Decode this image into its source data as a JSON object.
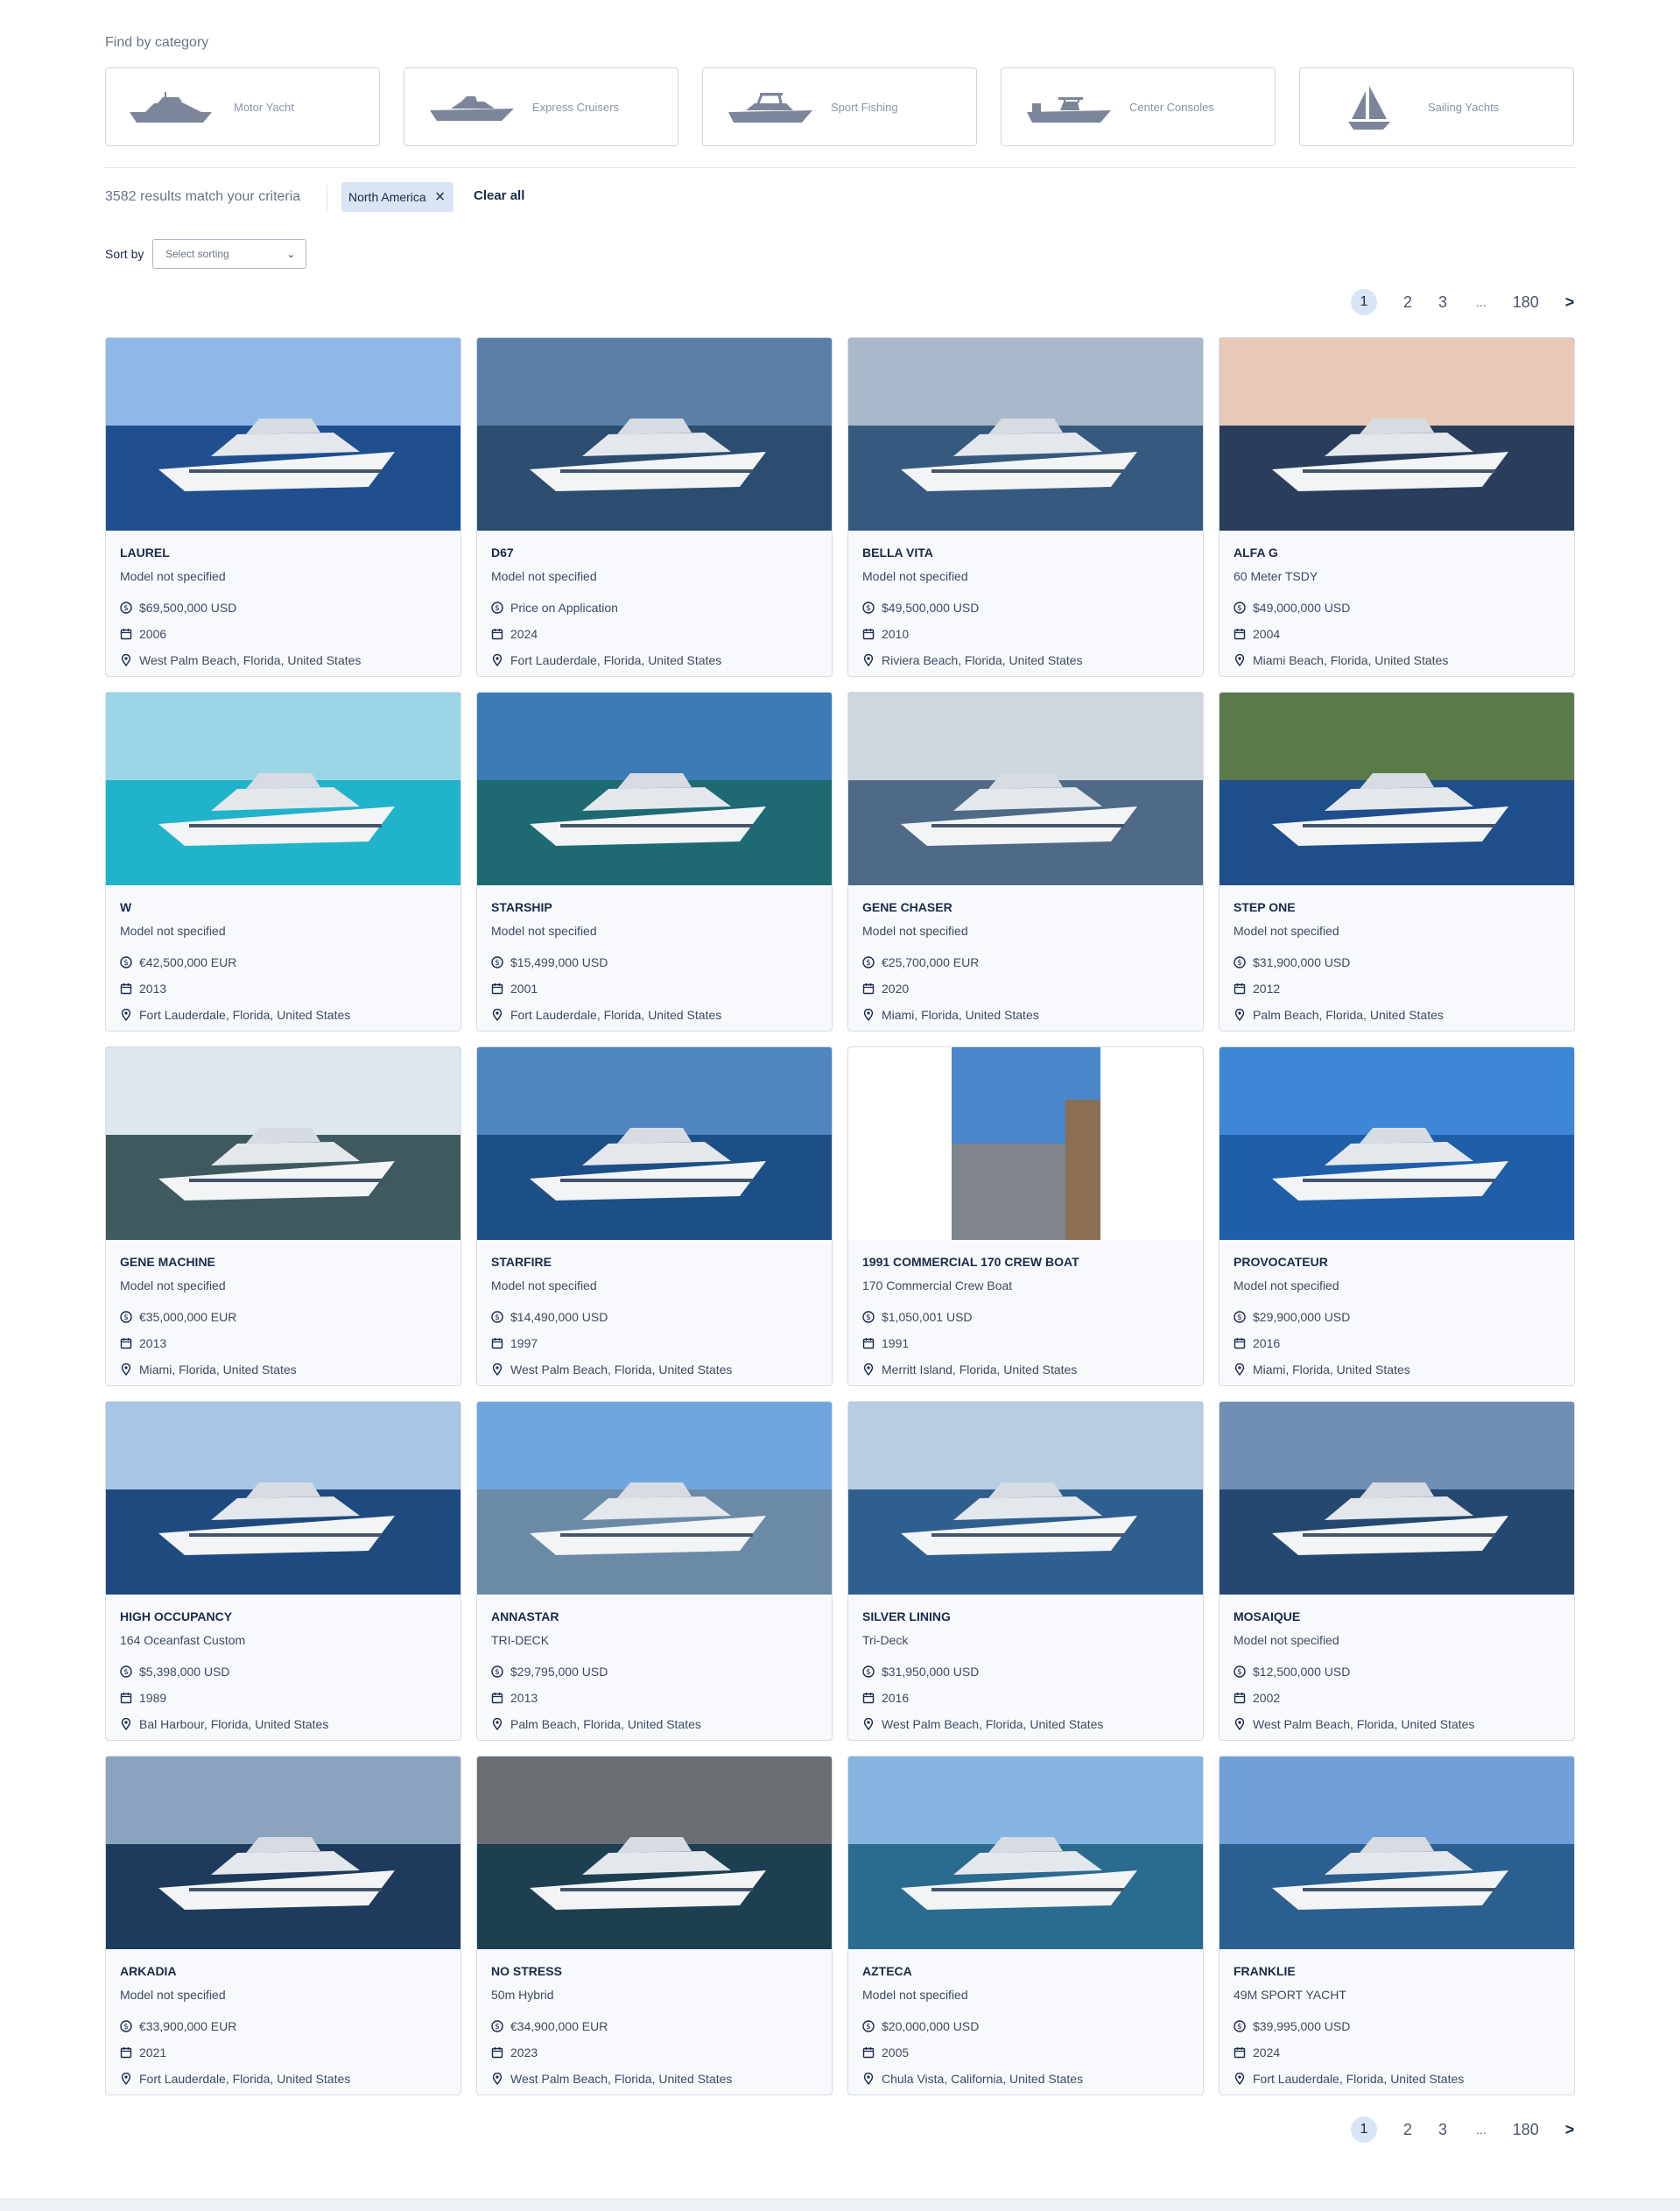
{
  "find_title": "Find by category",
  "categories": [
    {
      "label": "Motor Yacht",
      "icon": "motor-yacht-icon"
    },
    {
      "label": "Express Cruisers",
      "icon": "express-cruiser-icon"
    },
    {
      "label": "Sport Fishing",
      "icon": "sport-fishing-icon"
    },
    {
      "label": "Center Consoles",
      "icon": "center-console-icon"
    },
    {
      "label": "Sailing Yachts",
      "icon": "sailboat-icon"
    }
  ],
  "results_text": "3582 results match your criteria",
  "filter_chip": "North America",
  "clear_all": "Clear all",
  "sort": {
    "label": "Sort by",
    "placeholder": "Select sorting"
  },
  "pagination": {
    "current": "1",
    "pages": [
      "2",
      "3"
    ],
    "dots": "...",
    "last": "180",
    "next": ">"
  },
  "colors": {
    "accent": "#d9e4f5",
    "text": "#1b2a4a",
    "icon": "#7c8599"
  },
  "listings": [
    {
      "name": "LAUREL",
      "model": "Model not specified",
      "price": "$69,500,000 USD",
      "year": "2006",
      "location": "West Palm Beach, Florida, United States"
    },
    {
      "name": "D67",
      "model": "Model not specified",
      "price": "Price on Application",
      "year": "2024",
      "location": "Fort Lauderdale, Florida, United States"
    },
    {
      "name": "BELLA VITA",
      "model": "Model not specified",
      "price": "$49,500,000 USD",
      "year": "2010",
      "location": "Riviera Beach, Florida, United States"
    },
    {
      "name": "ALFA G",
      "model": "60 Meter TSDY",
      "price": "$49,000,000 USD",
      "year": "2004",
      "location": "Miami Beach, Florida, United States"
    },
    {
      "name": "W",
      "model": "Model not specified",
      "price": "€42,500,000 EUR",
      "year": "2013",
      "location": "Fort Lauderdale, Florida, United States"
    },
    {
      "name": "STARSHIP",
      "model": "Model not specified",
      "price": "$15,499,000 USD",
      "year": "2001",
      "location": "Fort Lauderdale, Florida, United States"
    },
    {
      "name": "GENE CHASER",
      "model": "Model not specified",
      "price": "€25,700,000 EUR",
      "year": "2020",
      "location": "Miami, Florida, United States"
    },
    {
      "name": "STEP ONE",
      "model": "Model not specified",
      "price": "$31,900,000 USD",
      "year": "2012",
      "location": "Palm Beach, Florida, United States"
    },
    {
      "name": "GENE MACHINE",
      "model": "Model not specified",
      "price": "€35,000,000 EUR",
      "year": "2013",
      "location": "Miami, Florida, United States"
    },
    {
      "name": "STARFIRE",
      "model": "Model not specified",
      "price": "$14,490,000 USD",
      "year": "1997",
      "location": "West Palm Beach, Florida, United States"
    },
    {
      "name": "1991 COMMERCIAL 170 CREW BOAT",
      "model": "170 Commercial Crew Boat",
      "price": "$1,050,001 USD",
      "year": "1991",
      "location": "Merritt Island, Florida, United States"
    },
    {
      "name": "PROVOCATEUR",
      "model": "Model not specified",
      "price": "$29,900,000 USD",
      "year": "2016",
      "location": "Miami, Florida, United States"
    },
    {
      "name": "HIGH OCCUPANCY",
      "model": "164 Oceanfast Custom",
      "price": "$5,398,000 USD",
      "year": "1989",
      "location": "Bal Harbour, Florida, United States"
    },
    {
      "name": "ANNASTAR",
      "model": "TRI-DECK",
      "price": "$29,795,000 USD",
      "year": "2013",
      "location": "Palm Beach, Florida, United States"
    },
    {
      "name": "SILVER LINING",
      "model": "Tri-Deck",
      "price": "$31,950,000 USD",
      "year": "2016",
      "location": "West Palm Beach, Florida, United States"
    },
    {
      "name": "MOSAIQUE",
      "model": "Model not specified",
      "price": "$12,500,000 USD",
      "year": "2002",
      "location": "West Palm Beach, Florida, United States"
    },
    {
      "name": "ARKADIA",
      "model": "Model not specified",
      "price": "€33,900,000 EUR",
      "year": "2021",
      "location": "Fort Lauderdale, Florida, United States"
    },
    {
      "name": "NO STRESS",
      "model": "50m Hybrid",
      "price": "€34,900,000 EUR",
      "year": "2023",
      "location": "West Palm Beach, Florida, United States"
    },
    {
      "name": "AZTECA",
      "model": "Model not specified",
      "price": "$20,000,000 USD",
      "year": "2005",
      "location": "Chula Vista, California, United States"
    },
    {
      "name": "FRANKLIE",
      "model": "49M SPORT YACHT",
      "price": "$39,995,000 USD",
      "year": "2024",
      "location": "Fort Lauderdale, Florida, United States"
    }
  ]
}
